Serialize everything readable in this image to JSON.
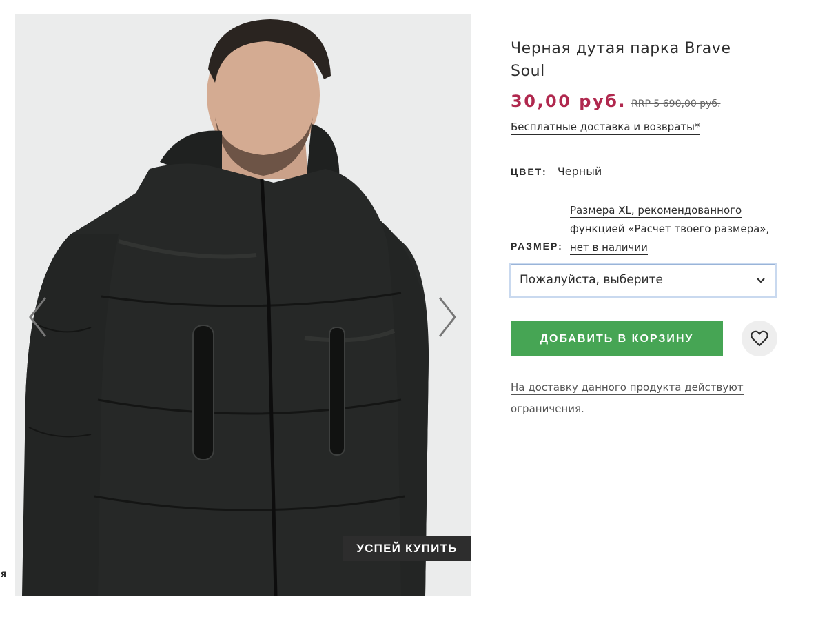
{
  "left_edge": {
    "stray_char": "я"
  },
  "gallery": {
    "image_alt": "Черная дутая парка Brave Soul",
    "badge": "УСПЕЙ КУПИТЬ",
    "prev_icon": "chevron-left-icon",
    "next_icon": "chevron-right-icon"
  },
  "product": {
    "title": "Черная дутая парка Brave Soul",
    "price_current": "30,00 руб.",
    "price_rrp": "RRP 5 690,00 руб.",
    "delivery_link": "Бесплатные доставка и возвраты*",
    "color_label": "ЦВЕТ:",
    "color_value": "Черный",
    "size_label": "РАЗМЕР:",
    "size_note_lines": [
      "Размера XL, рекомендованного",
      "функцией «Расчет твоего размера»,",
      "нет в наличии"
    ],
    "size_select_value": "Пожалуйста, выберите",
    "add_to_cart": "ДОБАВИТЬ В КОРЗИНУ",
    "wishlist_icon": "heart-icon",
    "restriction_lines": [
      "На доставку данного продукта действуют",
      "ограничения."
    ]
  },
  "colors": {
    "price_accent": "#b0284e",
    "add_button": "#46a554",
    "text": "#2d2d2d",
    "badge_bg": "#2d2d2d"
  }
}
